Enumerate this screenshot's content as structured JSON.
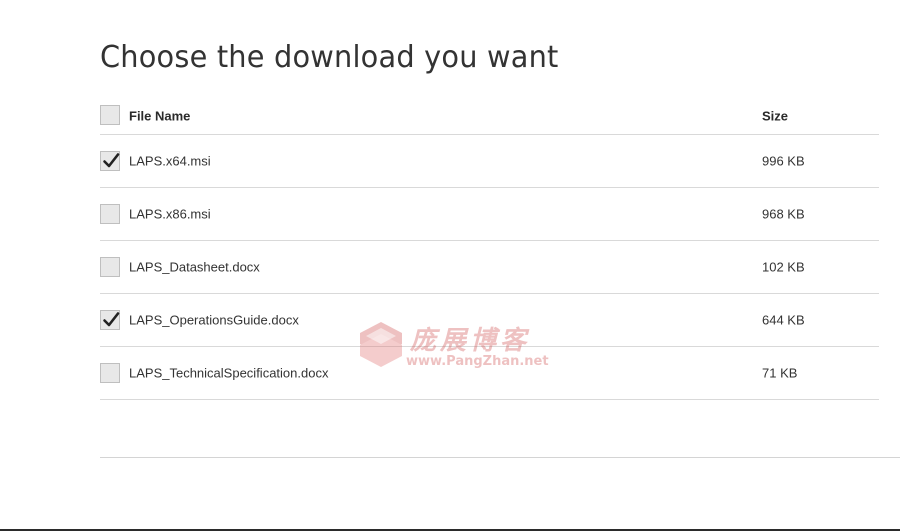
{
  "page": {
    "title": "Choose the download you want"
  },
  "table": {
    "headers": {
      "name": "File Name",
      "size": "Size"
    },
    "rows": [
      {
        "name": "LAPS.x64.msi",
        "size": "996 KB",
        "checked": true
      },
      {
        "name": "LAPS.x86.msi",
        "size": "968 KB",
        "checked": false
      },
      {
        "name": "LAPS_Datasheet.docx",
        "size": "102 KB",
        "checked": false
      },
      {
        "name": "LAPS_OperationsGuide.docx",
        "size": "644 KB",
        "checked": true
      },
      {
        "name": "LAPS_TechnicalSpecification.docx",
        "size": "71 KB",
        "checked": false
      }
    ],
    "select_all_checked": false
  },
  "watermark": {
    "title": "庞展博客",
    "url": "www.PangZhan.net"
  },
  "colors": {
    "checkbox_bg": "#e8e8e8",
    "checkbox_border": "#bfbfbf",
    "divider": "#d9d9d9",
    "text": "#333333",
    "watermark": "#d05050"
  }
}
